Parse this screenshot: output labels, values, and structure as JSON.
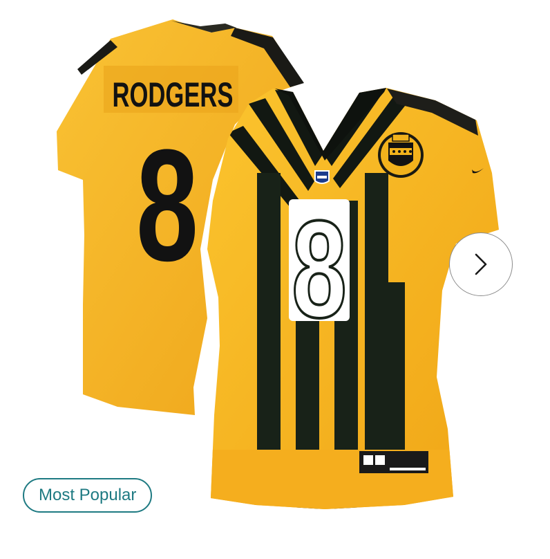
{
  "product": {
    "jersey_name": "RODGERS",
    "jersey_number": "8",
    "badge_label": "Most Popular"
  },
  "carousel": {
    "next_icon": "chevron-right-icon"
  },
  "colors": {
    "gold": "#F7B321",
    "gold_dark": "#E39A12",
    "black": "#111611",
    "stripe": "#182218",
    "white": "#FFFFFF",
    "accent": "#1E7A82"
  }
}
